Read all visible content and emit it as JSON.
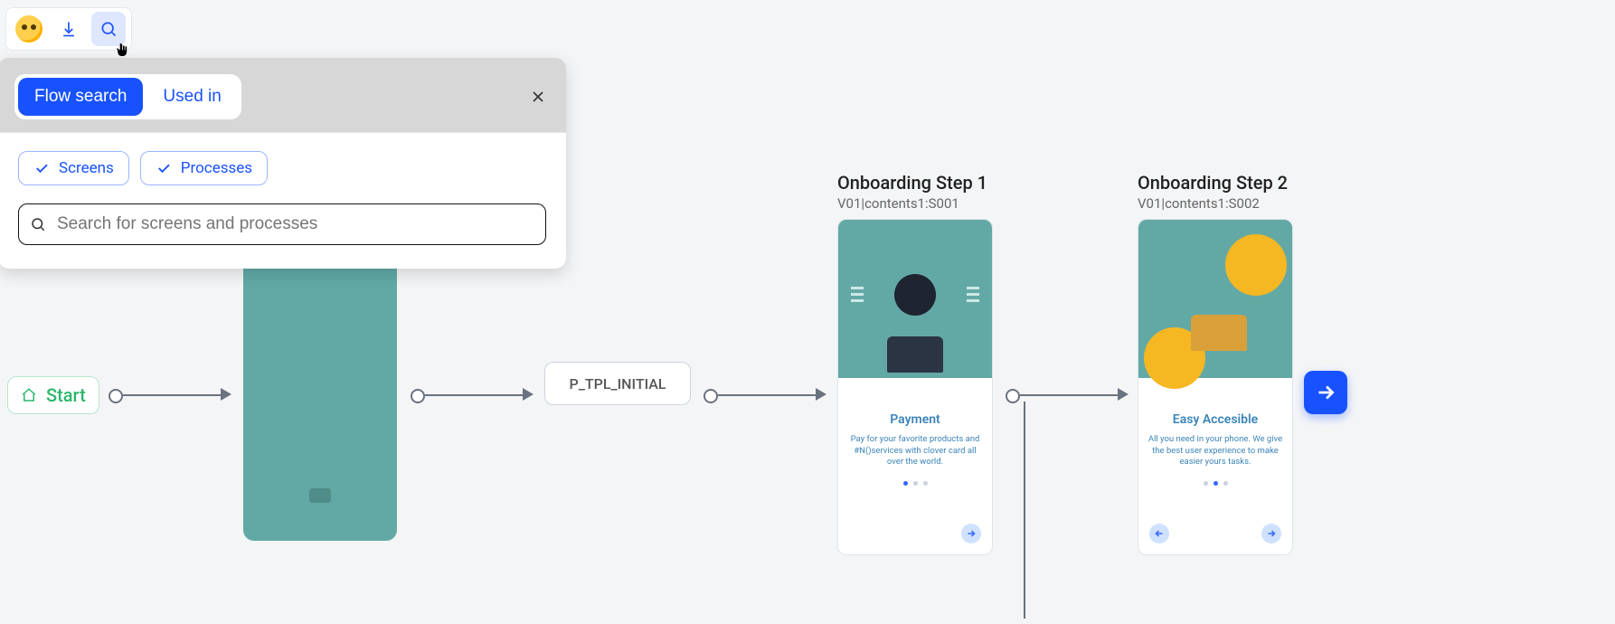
{
  "tools": {
    "logo_name": "brand-logo",
    "download_name": "download-icon",
    "search_name": "search-icon"
  },
  "panel": {
    "tabs": {
      "flow_search": "Flow search",
      "used_in": "Used in"
    },
    "chips": {
      "screens": "Screens",
      "processes": "Processes"
    },
    "search_placeholder": "Search for screens and processes"
  },
  "flow": {
    "start_label": "Start",
    "process_label": "P_TPL_INITIAL",
    "screens": [
      {
        "title": "Onboarding Step 1",
        "ref": "V01|contents1:S001",
        "heading": "Payment",
        "desc": "Pay for your favorite products and #N()services with clover card all over the world."
      },
      {
        "title": "Onboarding Step 2",
        "ref": "V01|contents1:S002",
        "heading": "Easy Accesible",
        "desc": "All you need in your phone. We give the best user experience to make easier yours tasks."
      }
    ]
  }
}
